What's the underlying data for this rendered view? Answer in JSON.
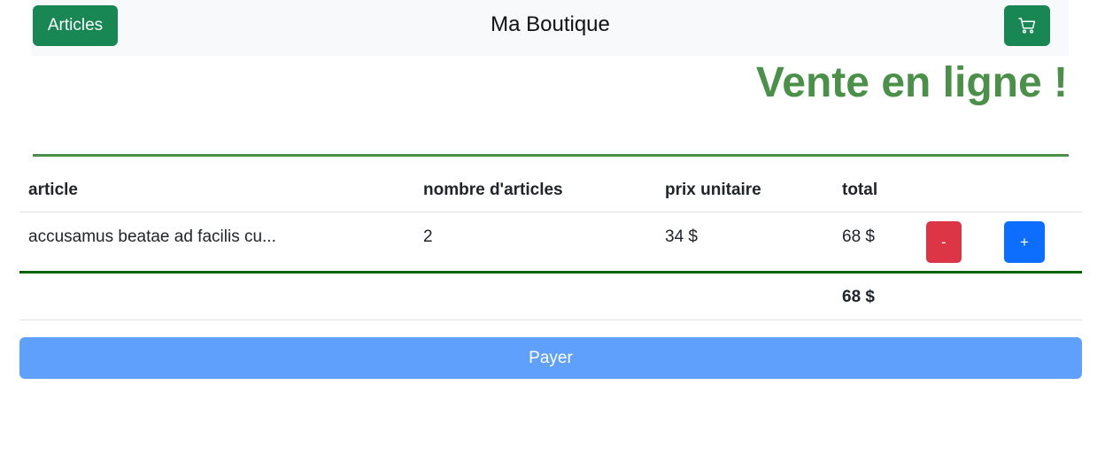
{
  "navbar": {
    "articles_label": "Articles",
    "brand": "Ma Boutique",
    "cart_icon": "cart-icon"
  },
  "hero": {
    "title": "Vente en ligne !"
  },
  "table": {
    "headers": {
      "article": "article",
      "quantity": "nombre d'articles",
      "unit_price": "prix unitaire",
      "total": "total"
    },
    "rows": [
      {
        "article": "accusamus beatae ad facilis cu...",
        "quantity": "2",
        "unit_price": "34 $",
        "total": "68 $",
        "minus_label": "-",
        "plus_label": "+"
      }
    ],
    "grand_total": "68 $"
  },
  "pay_label": "Payer",
  "colors": {
    "success": "#198754",
    "title_green": "#4a9049",
    "danger": "#dc3545",
    "primary": "#0d6efd",
    "pay_disabled": "#5fa0fd"
  }
}
